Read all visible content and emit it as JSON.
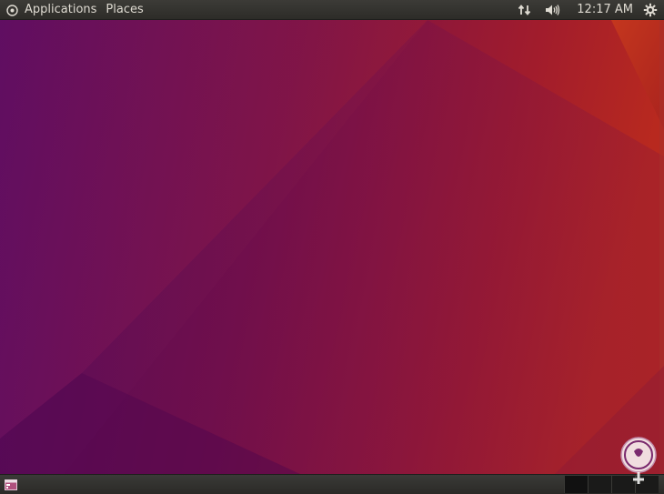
{
  "top_panel": {
    "menu": [
      {
        "label": "Applications"
      },
      {
        "label": "Places"
      }
    ],
    "indicators": {
      "network_icon": "network-arrows-icon",
      "volume_icon": "speaker-icon",
      "clock": "12:17 AM",
      "system_icon": "gear-icon"
    }
  },
  "bottom_panel": {
    "show_desktop_icon": "show-desktop-icon",
    "workspaces": 4
  },
  "colors": {
    "panel_bg": "#3c3b37",
    "panel_text": "#dfdbd2",
    "wallpaper_purple": "#5e0a5e",
    "wallpaper_red": "#a01e2a",
    "wallpaper_orange": "#c2361c"
  }
}
